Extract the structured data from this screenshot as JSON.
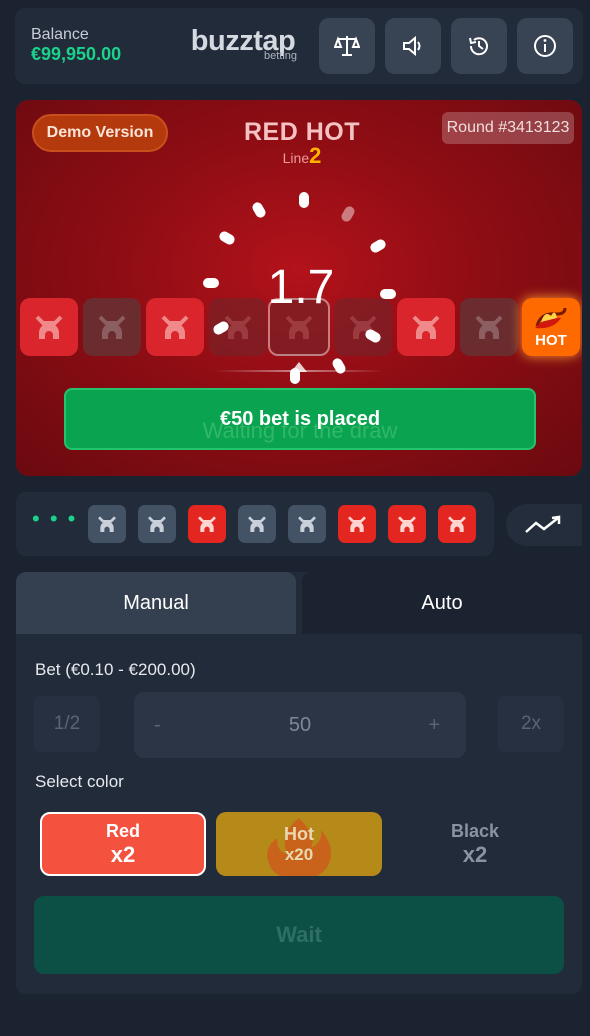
{
  "header": {
    "balance_label": "Balance",
    "balance_value": "€99,950.00",
    "logo_main": "buzztap",
    "logo_sub": "betting",
    "buttons": [
      "scales-icon",
      "sound-icon",
      "history-icon",
      "info-icon"
    ]
  },
  "game": {
    "demo_label": "Demo Version",
    "logo_main": "RED HOT",
    "logo_line": "Line",
    "logo_number": "2",
    "round_label": "Round #3413123",
    "multiplier": "1.7",
    "placed_message": "€50 bet is placed",
    "waiting_message": "Waiting for the draw",
    "hot_tile_label": "HOT",
    "reel": [
      "red",
      "grey",
      "red",
      "dim",
      "dim",
      "dim",
      "red",
      "grey",
      "hot"
    ]
  },
  "history": {
    "dots": "• • •",
    "tiles": [
      "dark",
      "dark",
      "red",
      "dark",
      "dark",
      "red",
      "red",
      "red"
    ]
  },
  "bet_panel": {
    "tabs": [
      "Manual",
      "Auto"
    ],
    "active_tab": "Manual",
    "bet_label": "Bet (€0.10 - €200.00)",
    "half_label": "1/2",
    "minus_label": "-",
    "bet_value": "50",
    "plus_label": "+",
    "double_label": "2x",
    "select_color_label": "Select color",
    "colors": [
      {
        "name": "Red",
        "multiplier": "x2"
      },
      {
        "name": "Hot",
        "multiplier": "x20"
      },
      {
        "name": "Black",
        "multiplier": "x2"
      }
    ],
    "action_label": "Wait"
  },
  "colors": {
    "balance_green": "#19d38a",
    "placed_green": "#0aa350",
    "red_tile": "#d9252b",
    "hot_orange": "#ff6a00"
  }
}
